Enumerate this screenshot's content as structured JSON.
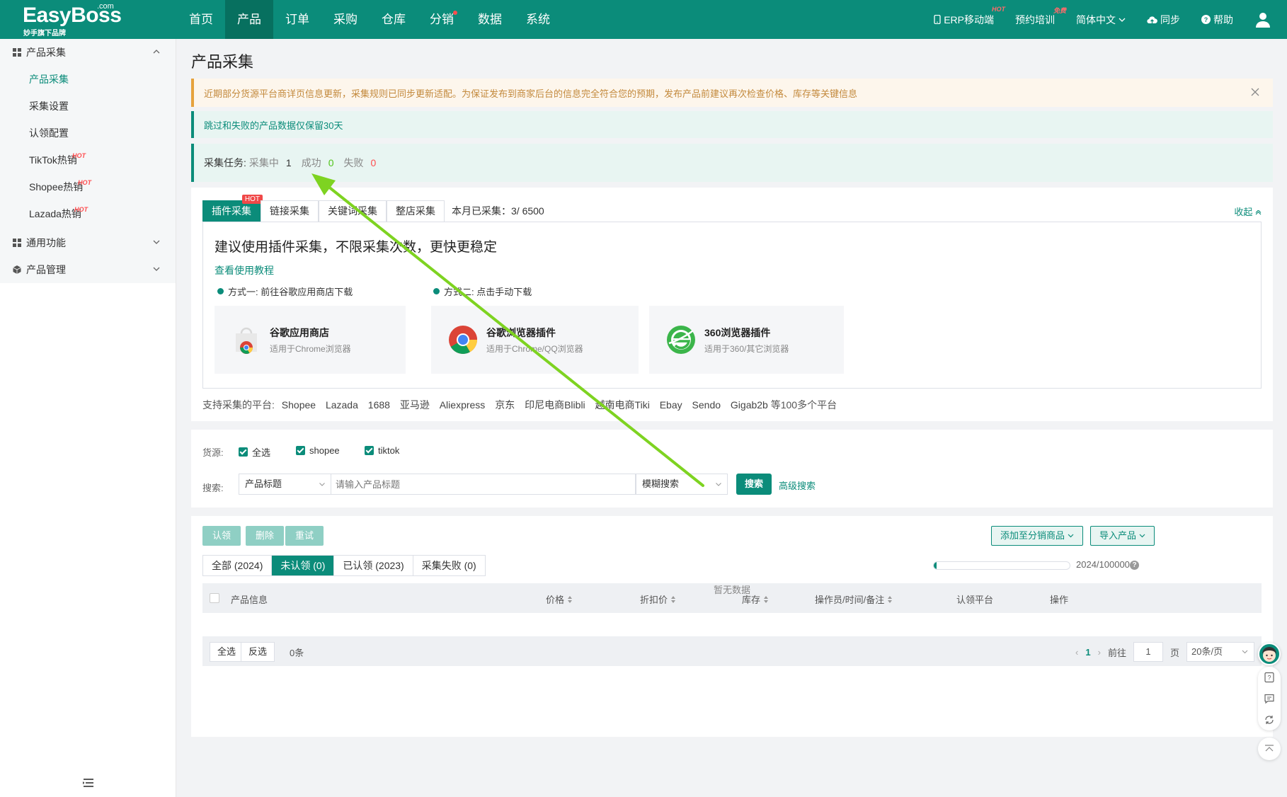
{
  "colors": {
    "primary": "#0b8c7a",
    "nav_active": "#07705f",
    "warn_bg": "#fdf6ec",
    "warn_text": "#c3893c",
    "success": "#52c41a",
    "danger": "#ff4d4f",
    "annotation_arrow": "#7ed321"
  },
  "header": {
    "brand": "EasyBoss",
    "brand_com": ".com",
    "brand_sub": "妙手旗下品牌",
    "nav": [
      {
        "label": "首页"
      },
      {
        "label": "产品",
        "active": true
      },
      {
        "label": "订单"
      },
      {
        "label": "采购"
      },
      {
        "label": "仓库"
      },
      {
        "label": "分销",
        "dot": true
      },
      {
        "label": "数据"
      },
      {
        "label": "系统"
      }
    ],
    "right": {
      "erp": "ERP移动端",
      "erp_badge": "HOT",
      "training": "预约培训",
      "training_badge": "免费",
      "language": "简体中文",
      "sync": "同步",
      "help": "帮助"
    }
  },
  "sidebar": {
    "groups": [
      {
        "label": "产品采集",
        "icon": "grid-icon"
      },
      {
        "label": "通用功能",
        "icon": "grid-icon"
      },
      {
        "label": "产品管理",
        "icon": "cube-icon"
      }
    ],
    "items": [
      {
        "label": "产品采集",
        "active": true
      },
      {
        "label": "采集设置"
      },
      {
        "label": "认领配置"
      },
      {
        "label": "TikTok热销",
        "badge": "HOT"
      },
      {
        "label": "Shopee热销",
        "badge": "HOT"
      },
      {
        "label": "Lazada热销",
        "badge": "HOT"
      }
    ]
  },
  "page": {
    "title": "产品采集",
    "alert_warn": "近期部分货源平台商详页信息更新，采集规则已同步更新适配。为保证发布到商家后台的信息完全符合您的预期，发布产品前建议再次检查价格、库存等关键信息",
    "alert_info": "跳过和失败的产品数据仅保留30天",
    "task": {
      "label": "采集任务:",
      "collecting_label": "采集中",
      "collecting": "1",
      "success_label": "成功",
      "success": "0",
      "fail_label": "失败",
      "fail": "0"
    }
  },
  "collect": {
    "tabs": [
      {
        "label": "插件采集",
        "active": true,
        "badge": "HOT"
      },
      {
        "label": "链接采集"
      },
      {
        "label": "关键词采集"
      },
      {
        "label": "整店采集"
      }
    ],
    "month_count": "本月已采集：3/ 6500",
    "collapse": "收起",
    "plugin_title": "建议使用插件采集，不限采集次数，更快更稳定",
    "tutorial": "查看使用教程",
    "way1": "方式一: 前往谷歌应用商店下载",
    "way2": "方式二: 点击手动下载",
    "stores": [
      {
        "name": "谷歌应用商店",
        "desc": "适用于Chrome浏览器",
        "icon": "chrome-store-icon"
      },
      {
        "name": "谷歌浏览器插件",
        "desc": "适用于Chrome/QQ浏览器",
        "icon": "chrome-icon"
      },
      {
        "name": "360浏览器插件",
        "desc": "适用于360/其它浏览器",
        "icon": "browser-360-icon"
      }
    ],
    "platforms_label": "支持采集的平台:",
    "platforms": [
      "Shopee",
      "Lazada",
      "1688",
      "亚马逊",
      "Aliexpress",
      "京东",
      "印尼电商Blibli",
      "越南电商Tiki",
      "Ebay",
      "Sendo",
      "Gigab2b"
    ],
    "platforms_suffix": "等100多个平台"
  },
  "filters": {
    "source_label": "货源:",
    "sources": [
      "全选",
      "shopee",
      "tiktok"
    ],
    "search_label": "搜索:",
    "field_select": "产品标题",
    "search_placeholder": "请输入产品标题",
    "mode_select": "模糊搜索",
    "search_button": "搜索",
    "advanced": "高级搜索"
  },
  "table": {
    "actions": [
      "认领",
      "删除",
      "重试"
    ],
    "add_distribution": "添加至分销商品",
    "import": "导入产品",
    "status_tabs": [
      {
        "label": "全部 (2024)"
      },
      {
        "label": "未认领 (0)",
        "active": true
      },
      {
        "label": "已认领 (2023)"
      },
      {
        "label": "采集失败 (0)"
      }
    ],
    "quota_text": "2024/100000",
    "quota_fraction": 0.02024,
    "columns": [
      {
        "label": "产品信息",
        "sortable": false
      },
      {
        "label": "价格",
        "sortable": true
      },
      {
        "label": "折扣价",
        "sortable": true
      },
      {
        "label": "库存",
        "sortable": true
      },
      {
        "label": "操作员/时间/备注",
        "sortable": true
      },
      {
        "label": "认领平台",
        "sortable": false
      },
      {
        "label": "操作",
        "sortable": false
      }
    ],
    "empty": "暂无数据",
    "select_all": "全选",
    "invert": "反选",
    "count": "0条",
    "page": "1",
    "goto_label": "前往",
    "goto_value": "1",
    "page_unit": "页",
    "page_size": "20条/页"
  }
}
